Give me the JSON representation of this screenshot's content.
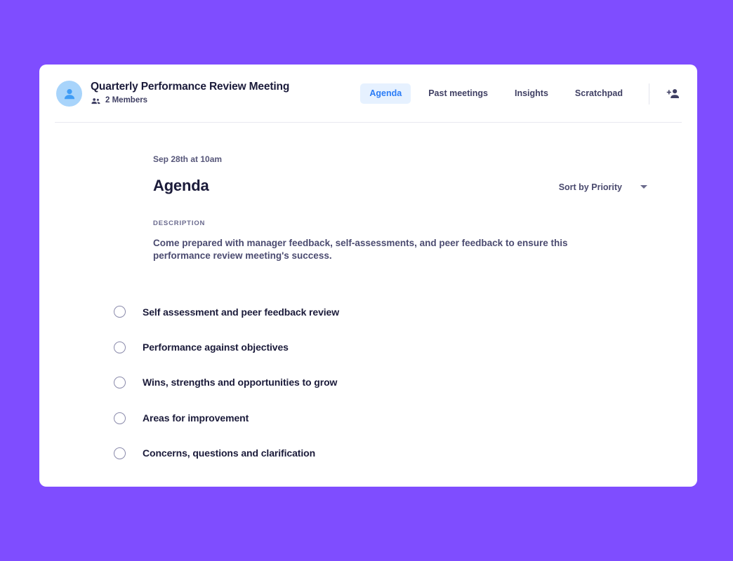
{
  "theme": {
    "page_background": "#7f4dff",
    "card_background": "#ffffff",
    "accent_blue": "#2b7cf6",
    "active_tab_background": "#e6f1ff",
    "avatar_background": "#a8d4fb",
    "heading_color": "#1b1b3a",
    "muted_text_color": "#4b4b70"
  },
  "header": {
    "avatar_icon": "person-avatar-icon",
    "title": "Quarterly Performance Review Meeting",
    "members_icon": "people-icon",
    "members_label": "2 Members",
    "tabs": [
      {
        "label": "Agenda",
        "active": true
      },
      {
        "label": "Past meetings",
        "active": false
      },
      {
        "label": "Insights",
        "active": false
      },
      {
        "label": "Scratchpad",
        "active": false
      }
    ],
    "add_member_icon": "person-add-icon"
  },
  "main": {
    "meeting_datetime": "Sep 28th at 10am",
    "page_title": "Agenda",
    "sort": {
      "label": "Sort by Priority",
      "chevron_icon": "chevron-down-icon"
    },
    "description": {
      "label": "DESCRIPTION",
      "text": "Come prepared with manager feedback, self-assessments, and peer feedback to ensure this performance review meeting's success."
    },
    "agenda_items": [
      {
        "label": "Self assessment and peer feedback review",
        "checked": false
      },
      {
        "label": "Performance against objectives",
        "checked": false
      },
      {
        "label": "Wins, strengths and opportunities to grow",
        "checked": false
      },
      {
        "label": "Areas for improvement",
        "checked": false
      },
      {
        "label": "Concerns, questions and clarification",
        "checked": false
      }
    ]
  }
}
